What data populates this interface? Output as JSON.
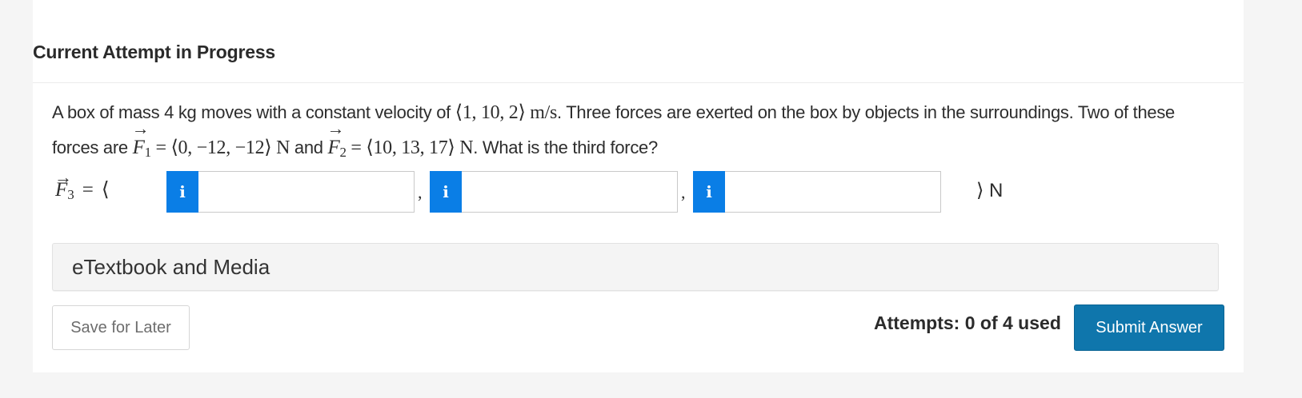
{
  "section": {
    "title": "Current Attempt in Progress"
  },
  "question": {
    "part1": "A box of mass 4 kg moves with a constant velocity of ",
    "velocity": "⟨1, 10, 2⟩",
    "velocity_unit": " m/s",
    "part2": ". Three forces are exerted on the box by objects in the surroundings. Two of these forces are ",
    "f1_symbol": "F",
    "f1_sub": "1",
    "f1_value": " = ⟨0, −12, −12⟩ ",
    "f1_unit": "N",
    "and": " and ",
    "f2_symbol": "F",
    "f2_sub": "2",
    "f2_value": " = ⟨10, 13, 17⟩ ",
    "f2_unit": "N",
    "part3": ". What is the third force?"
  },
  "answer": {
    "symbol": "F",
    "sub": "3",
    "equals": "=",
    "open": "⟨",
    "close": "⟩",
    "unit": "N",
    "comma": ",",
    "info_glyph": "i",
    "fields": [
      {
        "value": ""
      },
      {
        "value": ""
      },
      {
        "value": ""
      }
    ]
  },
  "etextbook": {
    "label": "eTextbook and Media"
  },
  "footer": {
    "save_label": "Save for Later",
    "attempts": "Attempts: 0 of 4 used",
    "submit_label": "Submit Answer"
  },
  "colors": {
    "info_button": "#0a7ee6",
    "submit_button": "#0f76ac"
  },
  "icons": {
    "info": "info-icon",
    "vector_arrow": "vector-arrow-icon"
  }
}
